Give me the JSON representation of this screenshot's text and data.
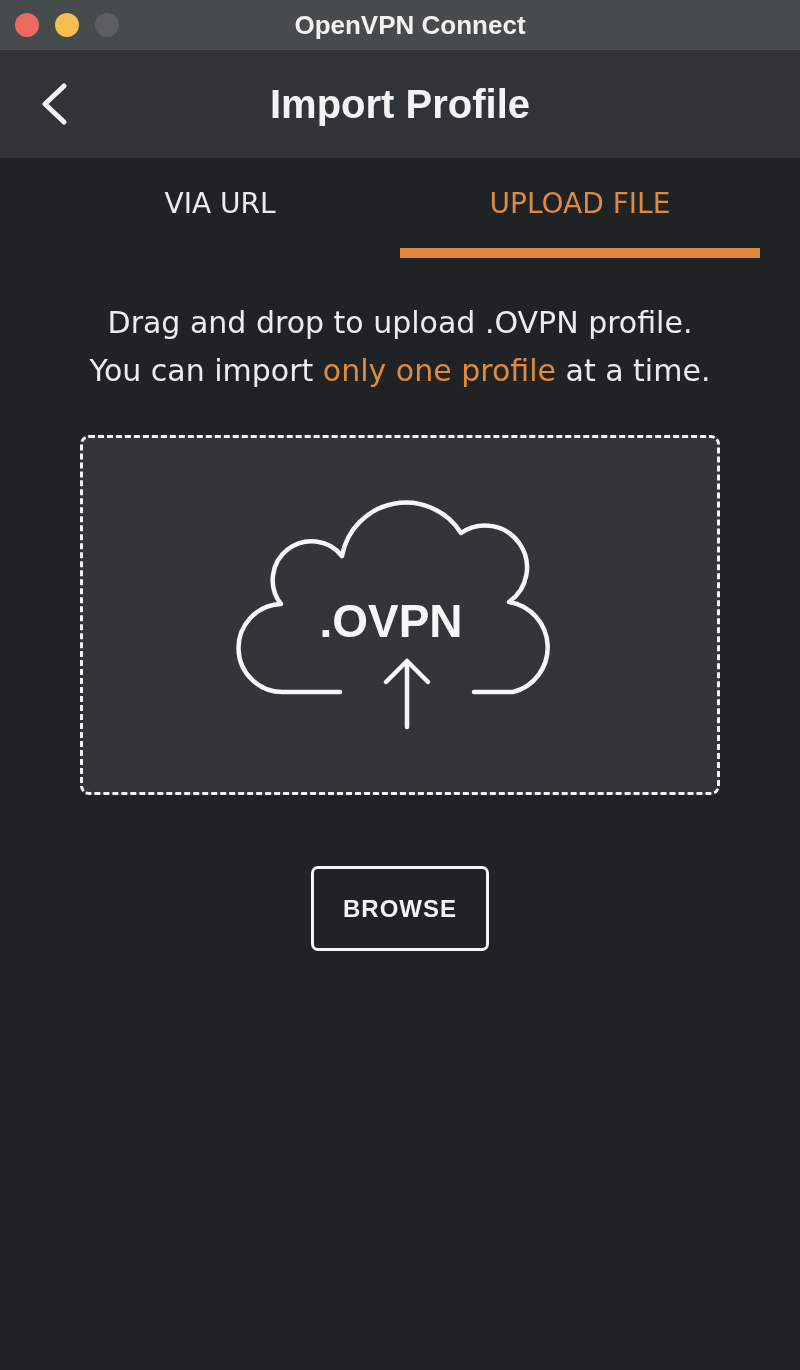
{
  "window": {
    "title": "OpenVPN Connect",
    "controls": [
      {
        "kind": "close",
        "disabled": false
      },
      {
        "kind": "minimize",
        "disabled": false
      },
      {
        "kind": "zoom",
        "disabled": true
      }
    ]
  },
  "header": {
    "title": "Import Profile"
  },
  "tabs": [
    {
      "label": "VIA URL",
      "selected": false
    },
    {
      "label": "UPLOAD FILE",
      "selected": true
    }
  ],
  "instructions": [
    "Drag and drop to upload .OVPN profile.",
    "You can import *only one profile* at a time."
  ],
  "drop_zone": {
    "label": ".OVPN"
  },
  "browse_button": {
    "label": "BROWSE"
  }
}
